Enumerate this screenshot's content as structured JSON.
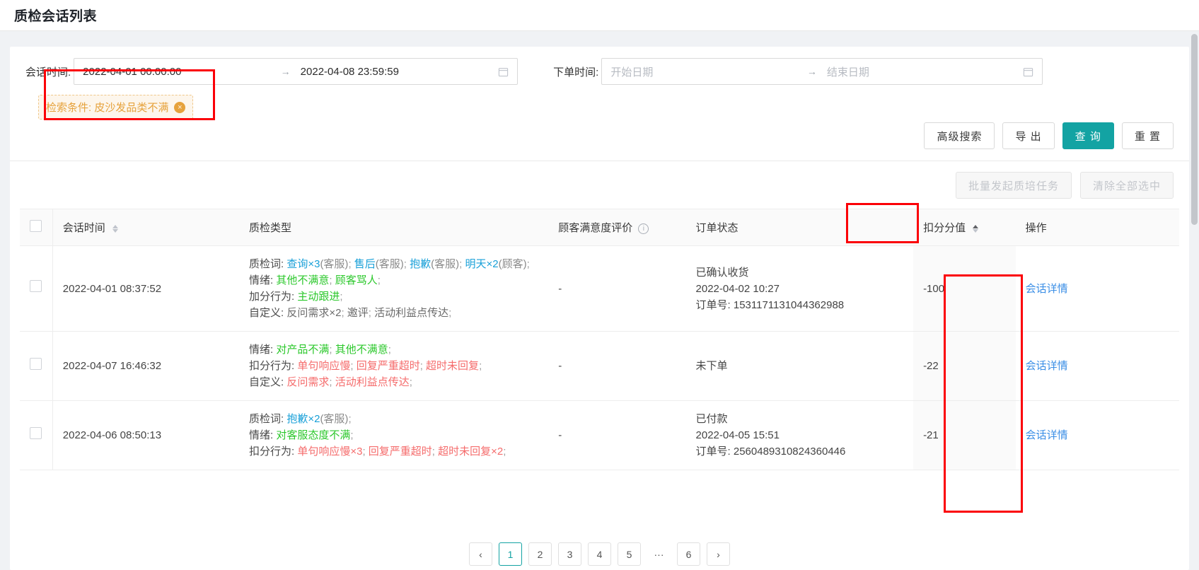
{
  "page": {
    "title": "质检会话列表"
  },
  "filters": {
    "session_time": {
      "label": "会话时间:",
      "start": "2022-04-01 00:00:00",
      "end": "2022-04-08 23:59:59",
      "separator": "→",
      "calendar_icon": "calendar-icon"
    },
    "order_time": {
      "label": "下单时间:",
      "start_placeholder": "开始日期",
      "end_placeholder": "结束日期",
      "separator": "→",
      "calendar_icon": "calendar-icon"
    },
    "condition_tag": {
      "prefix": "检索条件:",
      "value": "皮沙发品类不满",
      "close_icon": "×"
    }
  },
  "actions": {
    "advanced_search": "高级搜索",
    "export": "导 出",
    "query": "查 询",
    "reset": "重 置",
    "primary_color": "#13a3a3"
  },
  "bulk": {
    "start_task": "批量发起质培任务",
    "clear_selection": "清除全部选中"
  },
  "table": {
    "columns": [
      {
        "key": "check",
        "label": ""
      },
      {
        "key": "session_time",
        "label": "会话时间",
        "sortable": true
      },
      {
        "key": "qc_type",
        "label": "质检类型"
      },
      {
        "key": "satisfaction",
        "label": "顾客满意度评价",
        "info": true
      },
      {
        "key": "order_status",
        "label": "订单状态"
      },
      {
        "key": "score",
        "label": "扣分分值",
        "sortable": true,
        "sort_dir": "asc"
      },
      {
        "key": "action",
        "label": "操作"
      }
    ],
    "rows": [
      {
        "session_time": "2022-04-01 08:37:52",
        "qc": {
          "words_label": "质检词:",
          "words": [
            {
              "term": "查询×3",
              "role": "(客服)",
              "color": "blue"
            },
            {
              "term": "售后",
              "role": "(客服)",
              "color": "blue"
            },
            {
              "term": "抱歉",
              "role": "(客服)",
              "color": "blue"
            },
            {
              "term": "明天×2",
              "role": "(顾客)",
              "color": "blue"
            }
          ],
          "emotion_label": "情绪:",
          "emotions": [
            {
              "term": "其他不满意",
              "color": "green"
            },
            {
              "term": "顾客骂人",
              "color": "green"
            }
          ],
          "bonus_label": "加分行为:",
          "bonus": [
            {
              "term": "主动跟进",
              "color": "green"
            }
          ],
          "custom_label": "自定义:",
          "custom": [
            {
              "term": "反问需求×2",
              "color": "gray"
            },
            {
              "term": "邀评",
              "color": "gray"
            },
            {
              "term": "活动利益点传达",
              "color": "gray"
            }
          ]
        },
        "satisfaction": "-",
        "order_status": "已确认收货",
        "order_time": "2022-04-02 10:27",
        "order_no_label": "订单号:",
        "order_no": "1531171131044362988",
        "score": "-100",
        "action": "会话详情"
      },
      {
        "session_time": "2022-04-07 16:46:32",
        "qc": {
          "emotion_label": "情绪:",
          "emotions": [
            {
              "term": "对产品不满",
              "color": "green"
            },
            {
              "term": "其他不满意",
              "color": "green"
            }
          ],
          "deduct_label": "扣分行为:",
          "deduct": [
            {
              "term": "单句响应慢",
              "color": "red"
            },
            {
              "term": "回复严重超时",
              "color": "red"
            },
            {
              "term": "超时未回复",
              "color": "red"
            }
          ],
          "custom_label": "自定义:",
          "custom": [
            {
              "term": "反问需求",
              "color": "red"
            },
            {
              "term": "活动利益点传达",
              "color": "red"
            }
          ]
        },
        "satisfaction": "-",
        "order_status": "未下单",
        "order_time": "",
        "order_no_label": "",
        "order_no": "",
        "score": "-22",
        "action": "会话详情"
      },
      {
        "session_time": "2022-04-06 08:50:13",
        "qc": {
          "words_label": "质检词:",
          "words": [
            {
              "term": "抱歉×2",
              "role": "(客服)",
              "color": "blue"
            }
          ],
          "emotion_label": "情绪:",
          "emotions": [
            {
              "term": "对客服态度不满",
              "color": "green"
            }
          ],
          "deduct_label": "扣分行为:",
          "deduct": [
            {
              "term": "单句响应慢×3",
              "color": "red"
            },
            {
              "term": "回复严重超时",
              "color": "red"
            },
            {
              "term": "超时未回复×2",
              "color": "red"
            }
          ]
        },
        "satisfaction": "-",
        "order_status": "已付款",
        "order_time": "2022-04-05 15:51",
        "order_no_label": "订单号:",
        "order_no": "2560489310824360446",
        "score": "-21",
        "action": "会话详情"
      }
    ]
  },
  "pagination": {
    "prev": "‹",
    "pages": [
      "1",
      "2",
      "3",
      "4",
      "5",
      "6"
    ],
    "current": "1",
    "gap": "···",
    "next": "›"
  }
}
